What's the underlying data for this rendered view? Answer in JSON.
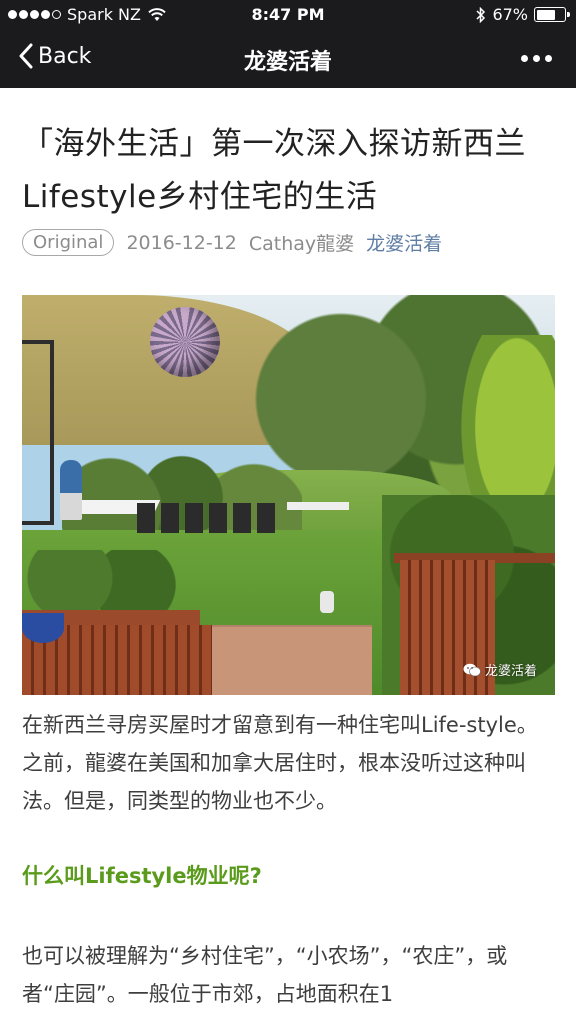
{
  "status_bar": {
    "carrier": "Spark NZ",
    "signal_bars_filled": 4,
    "signal_bars_total": 5,
    "time": "8:47 PM",
    "battery_percent": "67%",
    "battery_level": 0.67
  },
  "nav": {
    "back_label": "Back",
    "title": "龙婆活着"
  },
  "article": {
    "title": "「海外生活」第一次深入探访新西兰Lifestyle乡村住宅的生活",
    "meta": {
      "badge": "Original",
      "date": "2016-12-12",
      "author": "Cathay龍婆",
      "account": "龙婆活着"
    },
    "photo": {
      "watermark": "龙婆活着"
    },
    "paragraph_1": "在新西兰寻房买屋时才留意到有一种住宅叫Life-style。之前，龍婆在美国和加拿大居住时，根本没听过这种叫法。但是，同类型的物业也不少。",
    "subheading": "什么叫Lifestyle物业呢?",
    "paragraph_2": "也可以被理解为“乡村住宅”，“小农场”，“农庄”，或者“庄园”。一般位于市郊，占地面积在1"
  },
  "colors": {
    "nav_background": "#1b1b1e",
    "account_link": "#5f7ea6",
    "subheading": "#5a9b1b"
  }
}
